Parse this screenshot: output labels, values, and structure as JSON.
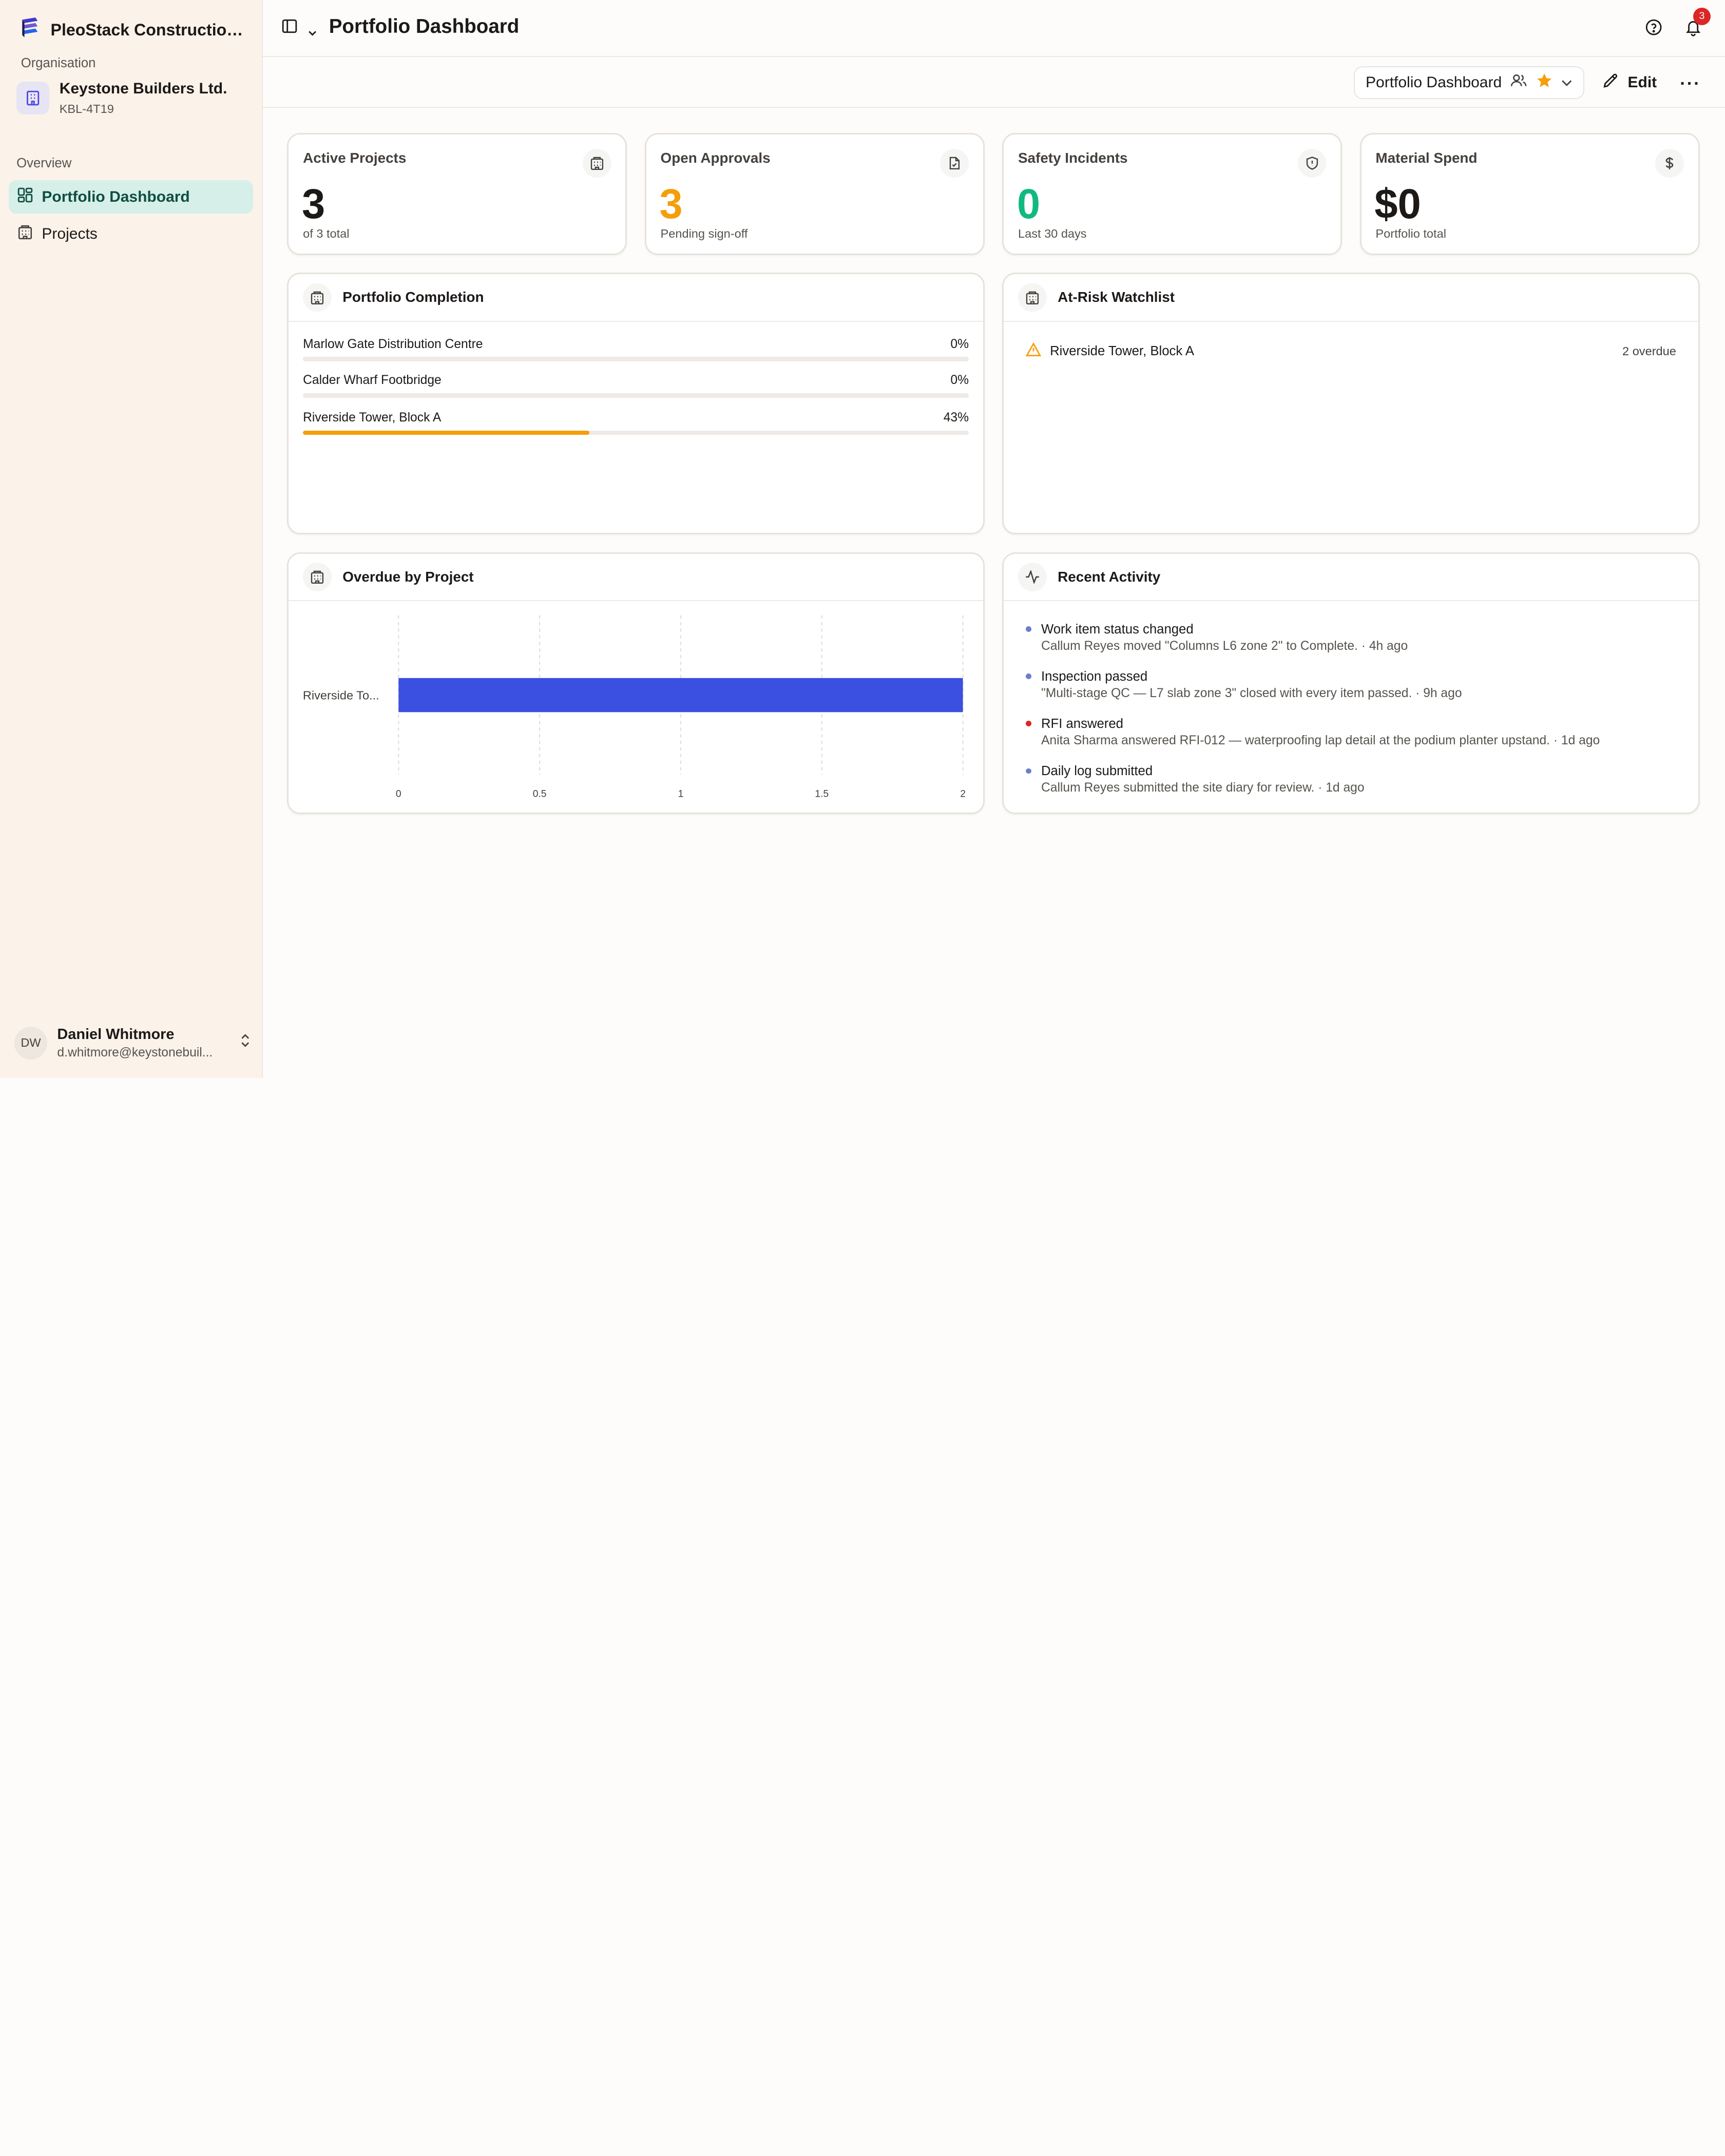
{
  "app": {
    "name": "PleoStack Construction ..."
  },
  "organisation": {
    "label": "Organisation",
    "name": "Keystone Builders Ltd.",
    "code": "KBL-4T19"
  },
  "nav": {
    "section": "Overview",
    "items": [
      {
        "label": "Portfolio Dashboard",
        "icon": "dashboard-icon",
        "active": true
      },
      {
        "label": "Projects",
        "icon": "building-icon",
        "active": false
      }
    ]
  },
  "user": {
    "initials": "DW",
    "name": "Daniel Whitmore",
    "email": "d.whitmore@keystonebuil..."
  },
  "header": {
    "title": "Portfolio Dashboard",
    "notifications": "3"
  },
  "toolbar": {
    "dashboard_name": "Portfolio Dashboard",
    "edit_label": "Edit",
    "more_label": "···"
  },
  "stats": [
    {
      "title": "Active Projects",
      "value": "3",
      "sub": "of 3 total",
      "icon": "building-icon",
      "color": "#1c1917"
    },
    {
      "title": "Open Approvals",
      "value": "3",
      "sub": "Pending sign-off",
      "icon": "document-check-icon",
      "color": "#f59e0b"
    },
    {
      "title": "Safety Incidents",
      "value": "0",
      "sub": "Last 30 days",
      "icon": "shield-icon",
      "color": "#10b981"
    },
    {
      "title": "Material Spend",
      "value": "$0",
      "sub": "Portfolio total",
      "icon": "dollar-icon",
      "color": "#1c1917"
    }
  ],
  "completion": {
    "title": "Portfolio Completion",
    "items": [
      {
        "name": "Marlow Gate Distribution Centre",
        "label": "0%",
        "value": 0
      },
      {
        "name": "Calder Wharf Footbridge",
        "label": "0%",
        "value": 0
      },
      {
        "name": "Riverside Tower, Block A",
        "label": "43%",
        "value": 43
      }
    ]
  },
  "watchlist": {
    "title": "At-Risk Watchlist",
    "items": [
      {
        "name": "Riverside Tower, Block A",
        "count": "2 overdue"
      }
    ]
  },
  "overdue": {
    "title": "Overdue by Project"
  },
  "chart_data": {
    "type": "bar",
    "orientation": "horizontal",
    "categories": [
      "Riverside To..."
    ],
    "values": [
      2
    ],
    "xlim": [
      0,
      2
    ],
    "ticks": [
      "0",
      "0.5",
      "1",
      "1.5",
      "2"
    ],
    "bar_color": "#3b4fe0",
    "grid": true
  },
  "activity": {
    "title": "Recent Activity",
    "items": [
      {
        "title": "Work item status changed",
        "desc": "Callum Reyes moved \"Columns L6 zone 2\" to Complete. · 4h ago",
        "color": "#6b7fcf"
      },
      {
        "title": "Inspection passed",
        "desc": "\"Multi-stage QC — L7 slab zone 3\" closed with every item passed. · 9h ago",
        "color": "#6b7fcf"
      },
      {
        "title": "RFI answered",
        "desc": "Anita Sharma answered RFI-012 — waterproofing lap detail at the podium planter upstand. · 1d ago",
        "color": "#dc2626"
      },
      {
        "title": "Daily log submitted",
        "desc": "Callum Reyes submitted the site diary for review. · 1d ago",
        "color": "#6b7fcf"
      }
    ]
  }
}
